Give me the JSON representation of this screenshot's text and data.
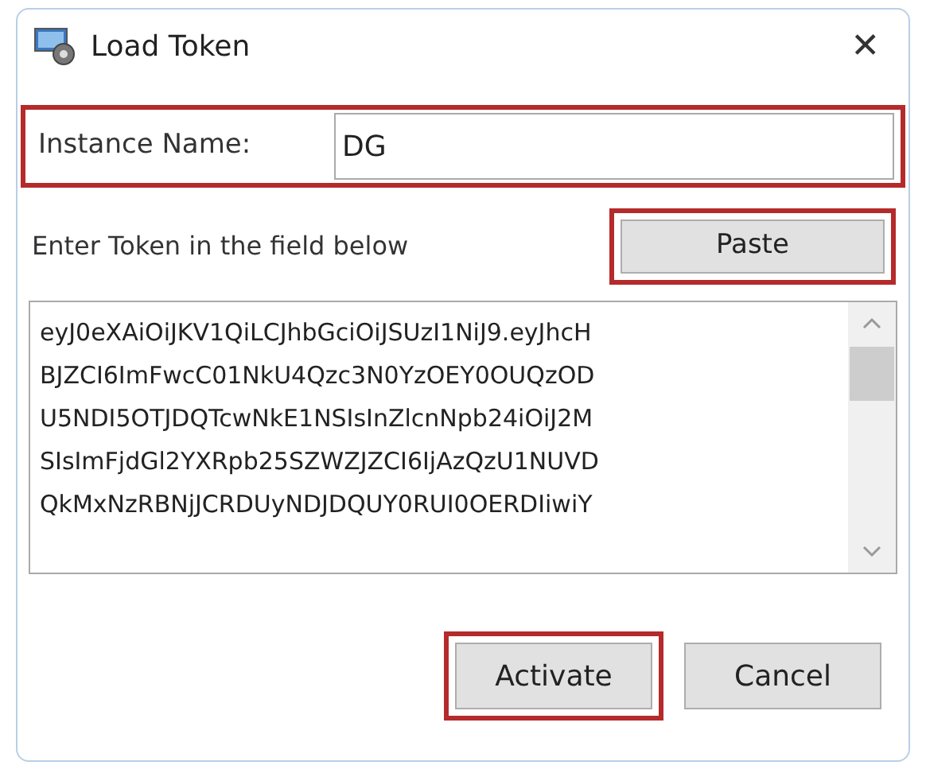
{
  "window": {
    "title": "Load Token",
    "close": "✕"
  },
  "instance": {
    "label": "Instance Name:",
    "value": "DG",
    "highlighted": true
  },
  "token": {
    "label": "Enter Token in the field below",
    "paste": {
      "label": "Paste",
      "highlighted": true
    },
    "lines": [
      "eyJ0eXAiOiJKV1QiLCJhbGciOiJSUzI1NiJ9.eyJhcH",
      "BJZCI6ImFwcC01NkU4Qzc3N0YzOEY0OUQzOD",
      "U5NDI5OTJDQTcwNkE1NSIsInZlcnNpb24iOiJ2M",
      "SIsImFjdGl2YXRpb25SZWZJZCI6IjAzQzU1NUVD",
      "QkMxNzRBNjJCRDUyNDJDQUY0RUI0OERDIiwiY"
    ]
  },
  "buttons": [
    {
      "label": "Activate",
      "highlighted": true
    },
    {
      "label": "Cancel",
      "highlighted": false
    }
  ]
}
